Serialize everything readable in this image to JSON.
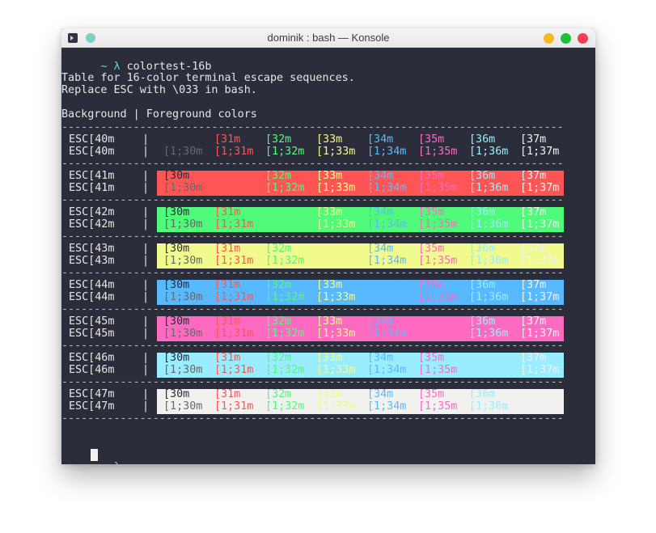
{
  "window": {
    "title": "dominik : bash — Konsole",
    "icons": [
      "terminal-app-icon",
      "pin-icon",
      "minimize-icon",
      "maximize-icon",
      "close-icon"
    ]
  },
  "colors": {
    "terminal_bg": "#2b2d3a",
    "prompt": "#66d9cf",
    "fg": {
      "30": "#2b2d3a",
      "31": "#ff5555",
      "32": "#50fa7b",
      "33": "#f1fa8c",
      "34": "#59b9ff",
      "35": "#ff6ac1",
      "36": "#9aedfe",
      "37": "#f1f1f0"
    },
    "fg_bold": {
      "30": "#686868",
      "31": "#ff5555",
      "32": "#50fa7b",
      "33": "#f1fa8c",
      "34": "#59b9ff",
      "35": "#ff6ac1",
      "36": "#9aedfe",
      "37": "#f1f1f0"
    },
    "bg": {
      "41": "#ff5555",
      "42": "#50fa7b",
      "43": "#f1fa8c",
      "44": "#59b9ff",
      "45": "#ff6ac1",
      "46": "#9aedfe",
      "47": "#f1f1f0"
    }
  },
  "terminal": {
    "prompt_symbol": "~ λ",
    "command": "colortest-16b",
    "intro_lines": [
      "Table for 16-color terminal escape sequences.",
      "Replace ESC with \\033 in bash."
    ],
    "header": "Background | Foreground colors",
    "separator": "--------------------------------------------------------------------------------",
    "fg_codes": [
      "30",
      "31",
      "32",
      "33",
      "34",
      "35",
      "36",
      "37"
    ],
    "normal_labels": [
      "[30m",
      "[31m",
      "[32m",
      "[33m",
      "[34m",
      "[35m",
      "[36m",
      "[37m"
    ],
    "bold_labels": [
      "[1;30m",
      "[1;31m",
      "[1;32m",
      "[1;33m",
      "[1;34m",
      "[1;35m",
      "[1;36m",
      "[1;37m"
    ],
    "bg_rows": [
      {
        "code": "40",
        "label": "ESC[40m",
        "pipe": "|"
      },
      {
        "code": "41",
        "label": "ESC[41m",
        "pipe": "|"
      },
      {
        "code": "42",
        "label": "ESC[42m",
        "pipe": "|"
      },
      {
        "code": "43",
        "label": "ESC[43m",
        "pipe": "|"
      },
      {
        "code": "44",
        "label": "ESC[44m",
        "pipe": "|"
      },
      {
        "code": "45",
        "label": "ESC[45m",
        "pipe": "|"
      },
      {
        "code": "46",
        "label": "ESC[46m",
        "pipe": "|"
      },
      {
        "code": "47",
        "label": "ESC[47m",
        "pipe": "|"
      }
    ],
    "final_prompt": "~ λ"
  }
}
